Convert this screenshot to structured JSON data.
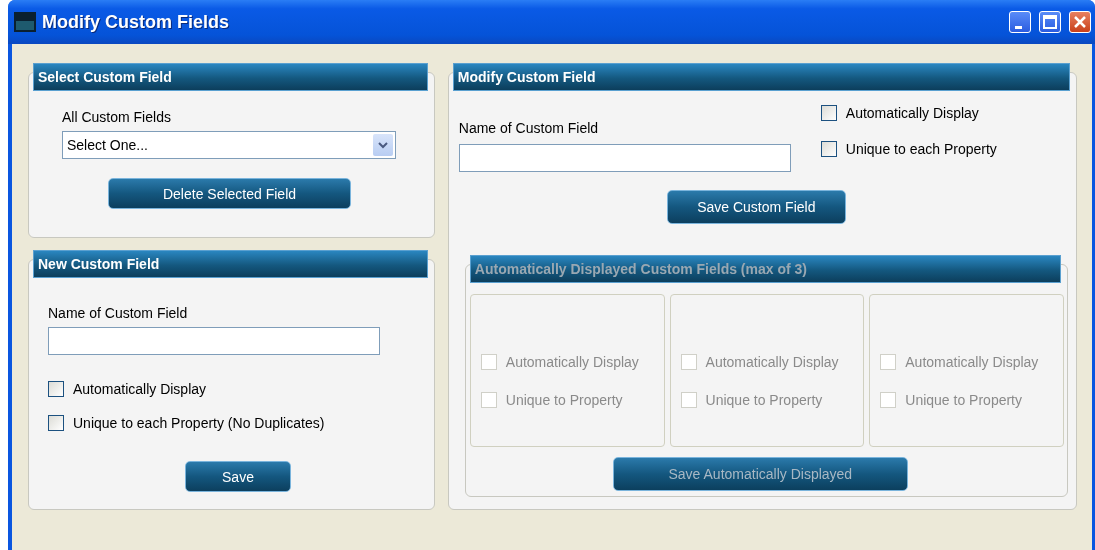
{
  "window": {
    "title": "Modify Custom Fields"
  },
  "select_panel": {
    "title": "Select Custom Field",
    "label": "All Custom Fields",
    "dropdown": {
      "value": "Select One..."
    },
    "button": "Delete Selected Field"
  },
  "new_panel": {
    "title": "New Custom Field",
    "field_label": "Name of Custom Field",
    "checkboxes": [
      {
        "label": "Automatically Display",
        "checked": false
      },
      {
        "label": "Unique to each Property (No Duplicates)",
        "checked": false
      }
    ],
    "button": "Save"
  },
  "modify_panel": {
    "title": "Modify Custom Field",
    "field_label": "Name of Custom Field",
    "checkboxes": [
      {
        "label": "Automatically Display",
        "checked": false
      },
      {
        "label": "Unique to each Property",
        "checked": false
      }
    ],
    "button": "Save Custom Field",
    "auto_section": {
      "title": "Automatically Displayed Custom Fields (max of 3)",
      "disabled": true,
      "slots": [
        {
          "checkboxes": [
            {
              "label": "Automatically Display",
              "checked": false
            },
            {
              "label": "Unique to Property",
              "checked": false
            }
          ]
        },
        {
          "checkboxes": [
            {
              "label": "Automatically Display",
              "checked": false
            },
            {
              "label": "Unique to Property",
              "checked": false
            }
          ]
        },
        {
          "checkboxes": [
            {
              "label": "Automatically Display",
              "checked": false
            },
            {
              "label": "Unique to Property",
              "checked": false
            }
          ]
        }
      ],
      "button": "Save Automatically Displayed"
    }
  }
}
